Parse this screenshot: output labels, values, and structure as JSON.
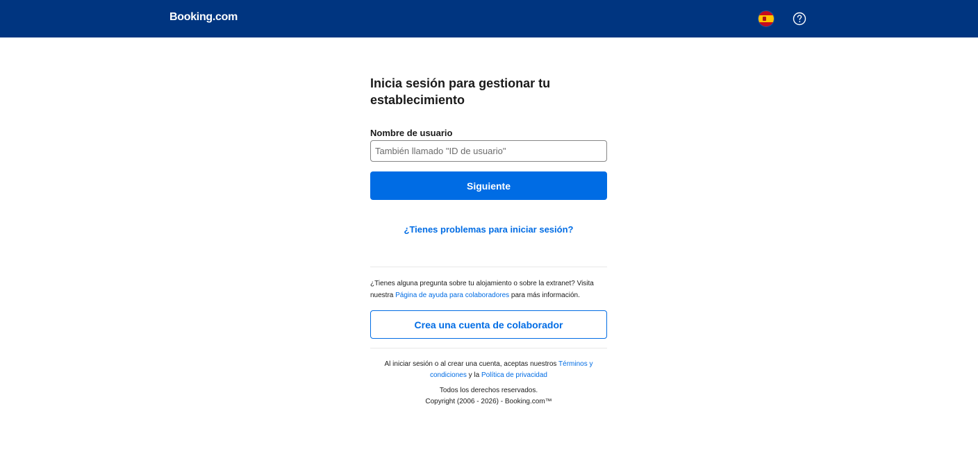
{
  "header": {
    "logo_text": "Booking.com",
    "language_icon": "spain-flag-icon",
    "help_icon": "question-circle-icon",
    "background_color": "#003580"
  },
  "login": {
    "title_line1": "Inicia sesión para gestionar tu",
    "title_line2": "establecimiento",
    "username_label": "Nombre de usuario",
    "username_value": "",
    "username_placeholder": "También llamado \"ID de usuario\"",
    "next_button": "Siguiente",
    "trouble_link": "¿Tienes problemas para iniciar sesión?",
    "accent_color": "#006ce4"
  },
  "help": {
    "text_before": "¿Tienes alguna pregunta sobre tu alojamiento o sobre la extranet? Visita nuestra ",
    "link_text": "Página de ayuda para colaboradores",
    "text_after": " para más información."
  },
  "create_account_button": "Crea una cuenta de colaborador",
  "footer": {
    "legal_before": "Al iniciar sesión o al crear una cuenta, aceptas nuestros ",
    "terms_link": "Términos y condiciones",
    "legal_middle": " y la ",
    "privacy_link": "Política de privacidad",
    "rights": "Todos los derechos reservados.",
    "copyright": "Copyright (2006 - 2026) - Booking.com™"
  }
}
